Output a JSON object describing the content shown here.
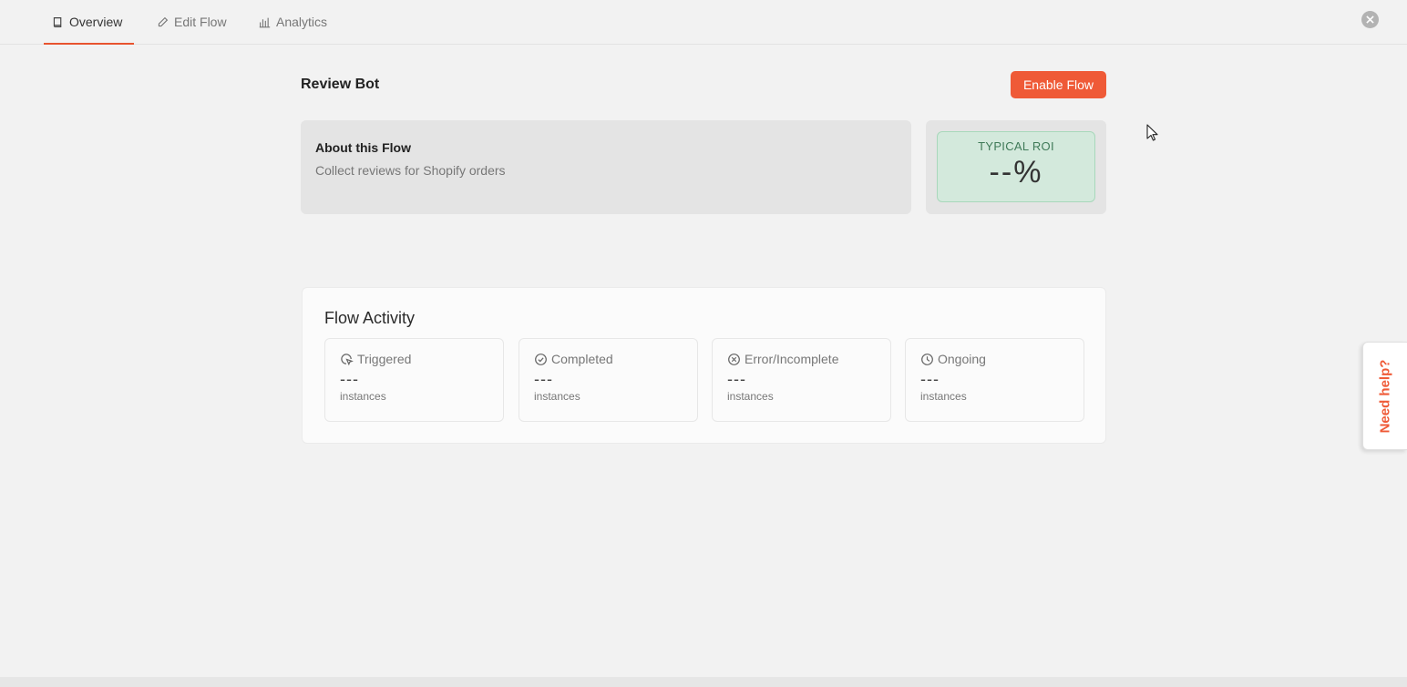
{
  "nav": {
    "tabs": [
      {
        "label": "Overview",
        "icon": "book-icon",
        "active": true
      },
      {
        "label": "Edit Flow",
        "icon": "pencil-icon",
        "active": false
      },
      {
        "label": "Analytics",
        "icon": "bar-chart-icon",
        "active": false
      }
    ],
    "close_icon": "close-icon"
  },
  "header": {
    "title": "Review Bot",
    "enable_label": "Enable Flow"
  },
  "about": {
    "title": "About this Flow",
    "description": "Collect reviews for Shopify orders"
  },
  "roi": {
    "label": "TYPICAL ROI",
    "value": "--%"
  },
  "activity": {
    "title": "Flow Activity",
    "stats": [
      {
        "label": "Triggered",
        "icon": "cursor-click-icon",
        "value": "---",
        "unit": "instances"
      },
      {
        "label": "Completed",
        "icon": "check-circle-icon",
        "value": "---",
        "unit": "instances"
      },
      {
        "label": "Error/Incomplete",
        "icon": "x-circle-icon",
        "value": "---",
        "unit": "instances"
      },
      {
        "label": "Ongoing",
        "icon": "clock-icon",
        "value": "---",
        "unit": "instances"
      }
    ]
  },
  "help": {
    "label": "Need help?"
  },
  "colors": {
    "accent": "#ef5a37",
    "roi_bg": "#d3e9dc",
    "roi_text": "#3f7a58"
  }
}
